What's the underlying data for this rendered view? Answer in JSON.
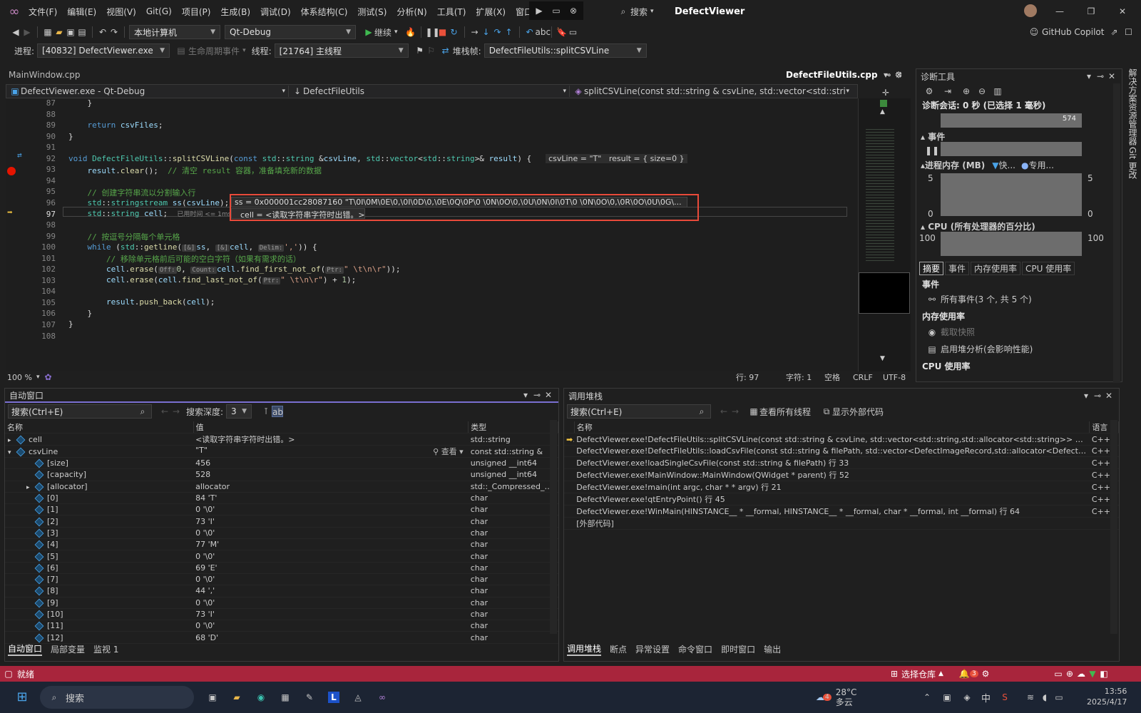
{
  "app": {
    "menu": [
      "文件(F)",
      "编辑(E)",
      "视图(V)",
      "Git(G)",
      "项目(P)",
      "生成(B)",
      "调试(D)",
      "体系结构(C)",
      "测试(S)",
      "分析(N)",
      "工具(T)",
      "扩展(X)",
      "窗口"
    ],
    "search_label": "搜索",
    "window_title": "DefectViewer",
    "copilot": "GitHub Copilot"
  },
  "toolbar": {
    "target": "本地计算机",
    "config": "Qt-Debug",
    "continue": "继续"
  },
  "debugbar": {
    "process_label": "进程:",
    "process": "[40832] DefectViewer.exe",
    "lifecycle": "生命周期事件",
    "thread_label": "线程:",
    "thread": "[21764] 主线程",
    "stackframe_label": "堆栈帧:",
    "stackframe": "DefectFileUtils::splitCSVLine"
  },
  "doctabs": {
    "inactive": "MainWindow.cpp",
    "active": "DefectFileUtils.cpp"
  },
  "navbar": {
    "project": "DefectViewer.exe - Qt-Debug",
    "scope": "DefectFileUtils",
    "member": "splitCSVLine(const std::string & csvLine, std::vector<std::string>& re"
  },
  "editor": {
    "lines": [
      "87",
      "88",
      "89",
      "90",
      "91",
      "92",
      "93",
      "94",
      "95",
      "96",
      "97",
      "98",
      "99",
      "100",
      "101",
      "102",
      "103",
      "104",
      "105",
      "106",
      "107",
      "108"
    ],
    "inline_values": "csvLine = \"T\"   result = { size=0 }",
    "elapsed_hint": "已用时间 <= 1ms",
    "datatip_ss": "ss = 0x000001cc28087160 \"T\\0I\\0M\\0E\\0,\\0I\\0D\\0,\\0E\\0Q\\0P\\0 \\0N\\0O\\0,\\0U\\0N\\0I\\0T\\0 \\0N\\0O\\0,\\0R\\0O\\0U\\0G\\...",
    "datatip_cell": "cell = <读取字符串字符时出错。>"
  },
  "editor_status": {
    "zoom": "100 %",
    "line": "行: 97",
    "col": "字符: 1",
    "space": "空格",
    "eol": "CRLF",
    "enc": "UTF-8"
  },
  "diag": {
    "title": "诊断工具",
    "session": "诊断会话: 0 秒 (已选择 1 毫秒)",
    "timeline_mark": "574",
    "events": "事件",
    "memory": "进程内存 (MB)",
    "mem_legend_fast": "快...",
    "mem_legend_private": "专用...",
    "mem_max": "5",
    "mem_min": "0",
    "cpu": "CPU (所有处理器的百分比)",
    "cpu_max": "100",
    "tabs": [
      "摘要",
      "事件",
      "内存使用率",
      "CPU 使用率"
    ],
    "sum_events": "事件",
    "all_events": "所有事件(3 个, 共 5 个)",
    "sum_memory": "内存使用率",
    "snapshot": "截取快照",
    "heap": "启用堆分析(会影响性能)",
    "sum_cpu": "CPU 使用率"
  },
  "rail": [
    "解决方案资源管理器",
    "Git 更改"
  ],
  "autos": {
    "title": "自动窗口",
    "search": "搜索(Ctrl+E)",
    "depth_label": "搜索深度:",
    "depth": "3",
    "cols": [
      "名称",
      "值",
      "类型"
    ],
    "view_label": "查看",
    "rows": [
      {
        "name": "cell",
        "value": "<读取字符串字符时出错。>",
        "type": "std::string"
      },
      {
        "name": "csvLine",
        "value": "\"T\"",
        "type": "const std::string &"
      },
      {
        "name": "[size]",
        "value": "456",
        "type": "unsigned __int64"
      },
      {
        "name": "[capacity]",
        "value": "528",
        "type": "unsigned __int64"
      },
      {
        "name": "[allocator]",
        "value": "allocator",
        "type": "std::_Compressed_pair..."
      },
      {
        "name": "[0]",
        "value": "84 'T'",
        "type": "char"
      },
      {
        "name": "[1]",
        "value": "0 '\\0'",
        "type": "char"
      },
      {
        "name": "[2]",
        "value": "73 'I'",
        "type": "char"
      },
      {
        "name": "[3]",
        "value": "0 '\\0'",
        "type": "char"
      },
      {
        "name": "[4]",
        "value": "77 'M'",
        "type": "char"
      },
      {
        "name": "[5]",
        "value": "0 '\\0'",
        "type": "char"
      },
      {
        "name": "[6]",
        "value": "69 'E'",
        "type": "char"
      },
      {
        "name": "[7]",
        "value": "0 '\\0'",
        "type": "char"
      },
      {
        "name": "[8]",
        "value": "44 ','",
        "type": "char"
      },
      {
        "name": "[9]",
        "value": "0 '\\0'",
        "type": "char"
      },
      {
        "name": "[10]",
        "value": "73 'I'",
        "type": "char"
      },
      {
        "name": "[11]",
        "value": "0 '\\0'",
        "type": "char"
      },
      {
        "name": "[12]",
        "value": "68 'D'",
        "type": "char"
      }
    ],
    "tabs": [
      "自动窗口",
      "局部变量",
      "监视 1"
    ]
  },
  "callstack": {
    "title": "调用堆栈",
    "search": "搜索(Ctrl+E)",
    "all_threads": "查看所有线程",
    "external": "显示外部代码",
    "cols": [
      "名称",
      "语言"
    ],
    "rows": [
      {
        "name": "DefectViewer.exe!DefectFileUtils::splitCSVLine(const std::string & csvLine, std::vector<std::string,std::allocator<std::string>> & result) 行 97",
        "lang": "C++"
      },
      {
        "name": "DefectViewer.exe!DefectFileUtils::loadCsvFile(const std::string & filePath, std::vector<DefectImageRecord,std::allocator<DefectImageRecord>> &...",
        "lang": "C++"
      },
      {
        "name": "DefectViewer.exe!loadSingleCsvFile(const std::string & filePath) 行 33",
        "lang": "C++"
      },
      {
        "name": "DefectViewer.exe!MainWindow::MainWindow(QWidget * parent) 行 52",
        "lang": "C++"
      },
      {
        "name": "DefectViewer.exe!main(int argc, char * * argv) 行 21",
        "lang": "C++"
      },
      {
        "name": "DefectViewer.exe!qtEntryPoint() 行 45",
        "lang": "C++"
      },
      {
        "name": "DefectViewer.exe!WinMain(HINSTANCE__ * __formal, HINSTANCE__ * __formal, char * __formal, int __formal) 行 64",
        "lang": "C++"
      },
      {
        "name": "[外部代码]",
        "lang": ""
      }
    ],
    "tabs": [
      "调用堆栈",
      "断点",
      "异常设置",
      "命令窗口",
      "即时窗口",
      "输出"
    ]
  },
  "statusbar": {
    "ready": "就绪",
    "repo": "选择仓库",
    "notif": "3"
  },
  "taskbar": {
    "search": "搜索",
    "weather_badge": "4",
    "temp": "28°C",
    "weather": "多云",
    "ime": "中",
    "time": "13:56",
    "date": "2025/4/17"
  }
}
